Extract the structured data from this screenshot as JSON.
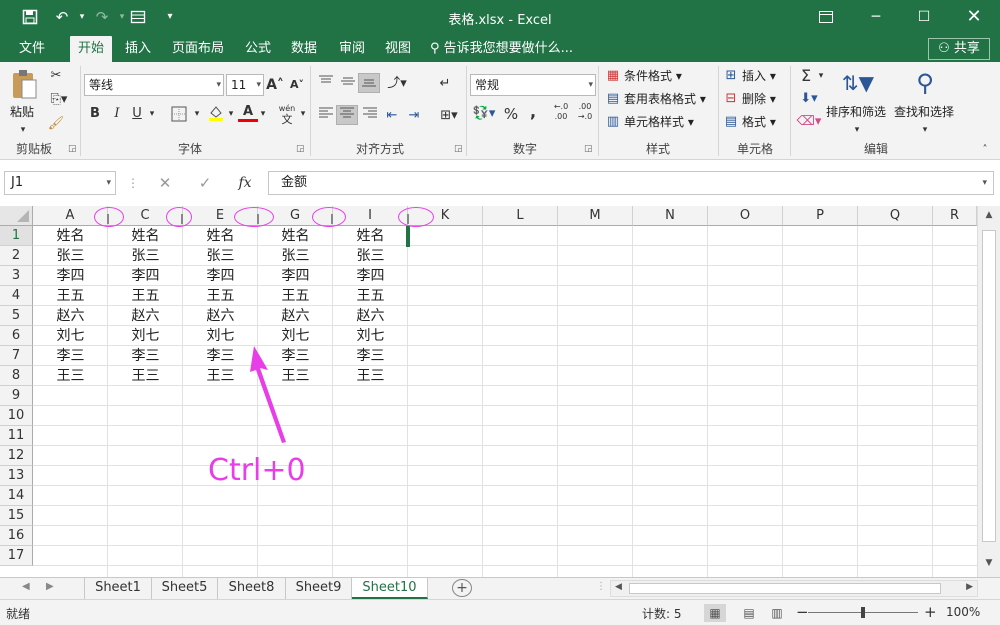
{
  "window": {
    "title": "表格.xlsx - Excel",
    "qat": [
      "save-icon",
      "undo-icon",
      "redo-icon",
      "form-icon",
      "customize-icon"
    ]
  },
  "tabs": [
    "文件",
    "开始",
    "插入",
    "页面布局",
    "公式",
    "数据",
    "审阅",
    "视图"
  ],
  "active_tab": "开始",
  "tell_me": "告诉我您想要做什么...",
  "share": "共享",
  "ribbon": {
    "clipboard": {
      "paste": "粘贴",
      "label": "剪贴板"
    },
    "font": {
      "name": "等线",
      "size": "11",
      "label": "字体",
      "bold": "B",
      "italic": "I",
      "underline": "U",
      "grow": "A",
      "shrink": "A",
      "phonetic": "文"
    },
    "alignment": {
      "label": "对齐方式"
    },
    "number": {
      "format": "常规",
      "label": "数字",
      "percent": "%",
      "comma": ","
    },
    "styles": {
      "conditional": "条件格式",
      "table": "套用表格格式",
      "cell": "单元格样式",
      "label": "样式"
    },
    "cells": {
      "insert": "插入",
      "delete": "删除",
      "format": "格式",
      "label": "单元格"
    },
    "editing": {
      "sort": "排序和筛选",
      "find": "查找和选择",
      "label": "编辑",
      "sum": "Σ"
    }
  },
  "formula_bar": {
    "name_box": "J1",
    "formula": "金额",
    "fx": "fx"
  },
  "grid": {
    "columns": [
      "A",
      "C",
      "E",
      "G",
      "I",
      "K",
      "L",
      "M",
      "N",
      "O",
      "P",
      "Q",
      "R"
    ],
    "rows": [
      "1",
      "2",
      "3",
      "4",
      "5",
      "6",
      "7",
      "8",
      "9",
      "10",
      "11",
      "12",
      "13",
      "14",
      "15",
      "16",
      "17"
    ],
    "data_rows": [
      [
        "姓名",
        "姓名",
        "姓名",
        "姓名",
        "姓名"
      ],
      [
        "张三",
        "张三",
        "张三",
        "张三",
        "张三"
      ],
      [
        "李四",
        "李四",
        "李四",
        "李四",
        "李四"
      ],
      [
        "王五",
        "王五",
        "王五",
        "王五",
        "王五"
      ],
      [
        "赵六",
        "赵六",
        "赵六",
        "赵六",
        "赵六"
      ],
      [
        "刘七",
        "刘七",
        "刘七",
        "刘七",
        "刘七"
      ],
      [
        "李三",
        "李三",
        "李三",
        "李三",
        "李三"
      ],
      [
        "王三",
        "王三",
        "王三",
        "王三",
        "王三"
      ]
    ]
  },
  "annotation": {
    "text": "Ctrl+0",
    "color": "#e83ee8"
  },
  "sheets": [
    "Sheet1",
    "Sheet5",
    "Sheet8",
    "Sheet9",
    "Sheet10"
  ],
  "active_sheet": "Sheet10",
  "status": {
    "ready": "就绪",
    "count": "计数: 5",
    "zoom": "100%"
  },
  "colors": {
    "accent": "#217346",
    "annotation": "#e83ee8"
  }
}
